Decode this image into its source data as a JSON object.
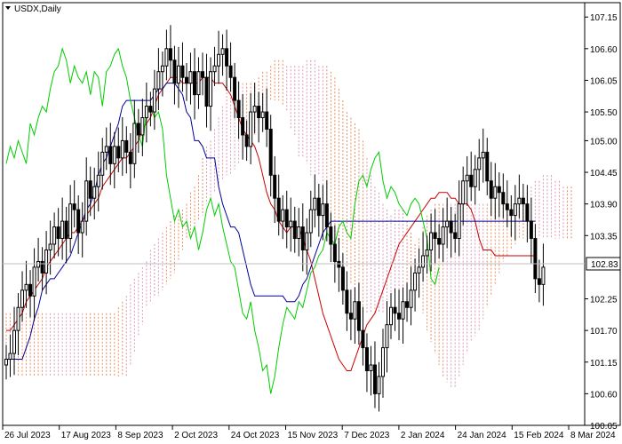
{
  "header": {
    "symbol_label": "USDX,Daily",
    "menu_icon": "triangle-down-icon"
  },
  "chart_data": {
    "type": "candlestick",
    "symbol": "USDX",
    "timeframe": "Daily",
    "indicator": "Ichimoku Kinko Hyo",
    "y_ticks": [
      "107.15",
      "106.60",
      "106.05",
      "105.50",
      "105.00",
      "104.45",
      "103.90",
      "103.35",
      "102.25",
      "101.70",
      "101.15",
      "100.60",
      "100.05"
    ],
    "ylim": [
      100.05,
      107.4
    ],
    "current_price": "102.83",
    "x_ticks": [
      "26 Jul 2023",
      "17 Aug 2023",
      "8 Sep 2023",
      "2 Oct 2023",
      "24 Oct 2023",
      "15 Nov 2023",
      "7 Dec 2023",
      "2 Jan 2024",
      "24 Jan 2024",
      "15 Feb 2024",
      "8 Mar 2024"
    ],
    "colors": {
      "tenkan": "#cc0000",
      "kijun": "#000099",
      "chikou": "#00cc00",
      "cloud_bull": "#e0703a",
      "cloud_bear": "#d080a8",
      "candle": "#000000",
      "grid": "#c0c0c0"
    },
    "series": [
      {
        "name": "close",
        "values": [
          101.2,
          101.3,
          101.7,
          102.1,
          102.4,
          102.5,
          102.3,
          102.8,
          102.9,
          102.7,
          103.1,
          103.2,
          103.5,
          103.3,
          103.6,
          103.3,
          103.9,
          103.8,
          103.4,
          103.6,
          104.3,
          104.0,
          104.2,
          104.4,
          104.8,
          104.9,
          104.6,
          104.9,
          104.7,
          105.0,
          104.8,
          104.6,
          105.3,
          105.1,
          105.4,
          105.6,
          105.5,
          105.9,
          106.2,
          106.3,
          106.6,
          106.4,
          106.0,
          106.3,
          106.1,
          106.0,
          106.2,
          105.8,
          106.2,
          106.1,
          105.6,
          106.2,
          106.3,
          106.5,
          106.6,
          106.3,
          106.1,
          105.7,
          105.4,
          105.1,
          104.9,
          105.5,
          105.6,
          105.4,
          105.5,
          105.2,
          104.4,
          104.0,
          103.6,
          103.8,
          103.5,
          103.6,
          103.3,
          103.5,
          103.1,
          103.4,
          103.8,
          104.0,
          103.7,
          103.9,
          103.5,
          103.2,
          102.9,
          102.8,
          102.4,
          102.0,
          101.9,
          102.2,
          101.7,
          101.4,
          101.0,
          101.1,
          100.6,
          100.9,
          101.4,
          101.8,
          102.1,
          102.0,
          101.9,
          102.2,
          102.1,
          102.4,
          102.7,
          102.8,
          103.0,
          103.1,
          103.4,
          103.3,
          103.2,
          103.5,
          103.6,
          103.4,
          103.3,
          103.9,
          104.3,
          104.4,
          104.2,
          104.5,
          104.7,
          104.8,
          104.3,
          104.0,
          104.2,
          104.1,
          103.9,
          103.8,
          103.7,
          103.9,
          104.0,
          103.9,
          103.6,
          103.3,
          102.6,
          102.5,
          102.8
        ]
      },
      {
        "name": "tenkan",
        "values": [
          101.7,
          101.7,
          101.8,
          101.9,
          102.0,
          102.2,
          102.3,
          102.4,
          102.5,
          102.6,
          102.8,
          102.9,
          103.0,
          103.1,
          103.2,
          103.3,
          103.4,
          103.4,
          103.5,
          103.6,
          103.7,
          103.8,
          103.9,
          104.0,
          104.2,
          104.3,
          104.4,
          104.5,
          104.6,
          104.7,
          104.7,
          104.8,
          104.9,
          105.0,
          105.2,
          105.3,
          105.4,
          105.6,
          105.8,
          105.9,
          106.0,
          106.1,
          106.1,
          106.1,
          106.0,
          106.0,
          106.0,
          106.0,
          106.0,
          106.1,
          106.1,
          106.1,
          106.0,
          106.0,
          106.0,
          105.9,
          105.8,
          105.6,
          105.4,
          105.2,
          105.1,
          105.0,
          104.9,
          104.7,
          104.4,
          104.1,
          103.9,
          103.8,
          103.6,
          103.5,
          103.4,
          103.5,
          103.5,
          103.5,
          103.3,
          103.1,
          102.9,
          102.6,
          102.3,
          102.0,
          101.8,
          101.6,
          101.4,
          101.2,
          101.1,
          101.0,
          101.0,
          101.2,
          101.4,
          101.6,
          101.8,
          101.9,
          102.0,
          102.2,
          102.4,
          102.6,
          102.8,
          103.0,
          103.2,
          103.3,
          103.4,
          103.5,
          103.6,
          103.7,
          103.8,
          103.9,
          104.0,
          104.0,
          104.1,
          104.1,
          104.1,
          104.0,
          104.0,
          103.9,
          103.9,
          103.9,
          103.8,
          103.6,
          103.3,
          103.1,
          103.1,
          103.1,
          103.0,
          103.0,
          103.0,
          103.0,
          103.0,
          103.0,
          103.0,
          103.0,
          103.0,
          103.0,
          103.0
        ]
      },
      {
        "name": "kijun",
        "values": [
          101.2,
          101.2,
          101.2,
          101.2,
          101.2,
          101.4,
          101.6,
          101.9,
          102.1,
          102.4,
          102.5,
          102.6,
          102.6,
          102.7,
          102.8,
          102.9,
          103.0,
          103.2,
          103.4,
          103.6,
          103.8,
          103.9,
          104.1,
          104.4,
          104.6,
          104.7,
          104.9,
          105.1,
          105.3,
          105.6,
          105.7,
          105.7,
          105.7,
          105.7,
          105.7,
          105.7,
          105.7,
          105.8,
          105.9,
          105.9,
          106.0,
          106.0,
          106.0,
          105.9,
          105.8,
          105.5,
          105.4,
          105.0,
          105.0,
          104.9,
          104.7,
          104.7,
          104.7,
          104.2,
          103.9,
          103.7,
          103.5,
          103.5,
          103.4,
          103.1,
          102.8,
          102.5,
          102.3,
          102.3,
          102.3,
          102.3,
          102.3,
          102.3,
          102.3,
          102.3,
          102.2,
          102.2,
          102.2,
          102.3,
          102.5,
          102.6,
          102.8,
          103.0,
          103.2,
          103.4,
          103.5,
          103.6,
          103.6,
          103.6,
          103.6,
          103.6,
          103.6,
          103.6,
          103.6,
          103.6,
          103.6,
          103.6,
          103.6,
          103.6,
          103.6,
          103.6,
          103.6,
          103.6,
          103.6,
          103.6,
          103.6,
          103.6,
          103.6,
          103.6,
          103.6,
          103.6,
          103.6,
          103.6,
          103.6,
          103.6,
          103.6,
          103.6,
          103.6,
          103.6,
          103.6,
          103.6,
          103.6,
          103.6,
          103.6,
          103.6,
          103.6,
          103.6,
          103.6,
          103.6,
          103.6,
          103.6,
          103.6,
          103.6,
          103.6,
          103.6,
          103.6,
          103.6,
          103.6
        ]
      }
    ]
  }
}
